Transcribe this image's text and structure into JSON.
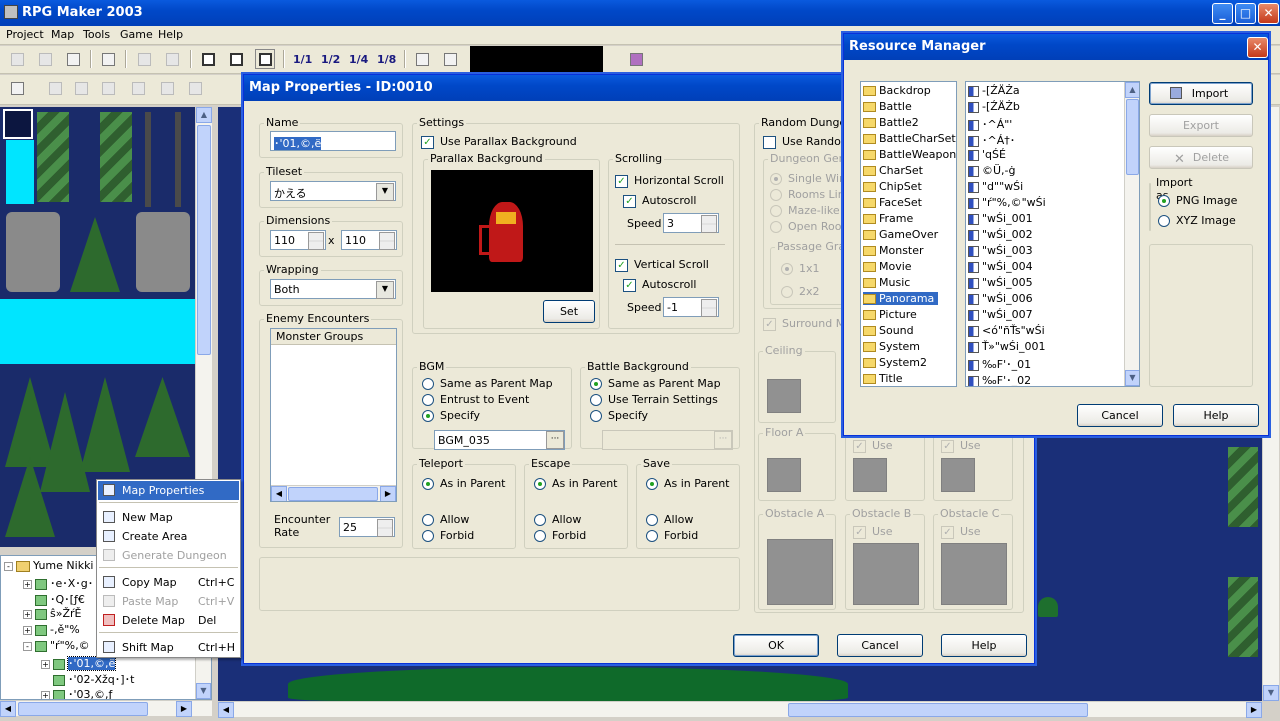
{
  "app": {
    "title": "RPG Maker 2003"
  },
  "menu": [
    "Project",
    "Map",
    "Tools",
    "Game",
    "Help"
  ],
  "toolbar_layer_buttons": [
    "1/1",
    "1/2",
    "1/4",
    "1/8"
  ],
  "tree": {
    "root": "Yume Nikki",
    "items": [
      "･e･X･g･",
      "･Q･[ƒ€",
      "ŝ»ŽŕĚ",
      "-‚ě\"%",
      "\"ŕ\"%‚©",
      "･'01,©,ë",
      "･'02-Xžq･]･t",
      "･'03,©,ƒ"
    ]
  },
  "context_menu": {
    "items": [
      {
        "label": "Map Properties",
        "shortcut": ""
      },
      {
        "label": "New Map",
        "shortcut": ""
      },
      {
        "label": "Create Area",
        "shortcut": ""
      },
      {
        "label": "Generate Dungeon",
        "shortcut": ""
      },
      {
        "label": "Copy Map",
        "shortcut": "Ctrl+C"
      },
      {
        "label": "Paste Map",
        "shortcut": "Ctrl+V"
      },
      {
        "label": "Delete Map",
        "shortcut": "Del"
      },
      {
        "label": "Shift Map",
        "shortcut": "Ctrl+H"
      }
    ]
  },
  "map_properties": {
    "title": "Map Properties - ID:0010",
    "name_label": "Name",
    "name_value": "･'01,©,ë",
    "tileset_label": "Tileset",
    "tileset_value": "かえる",
    "dimensions_label": "Dimensions",
    "width": "110",
    "height": "110",
    "x_sep": "x",
    "wrapping_label": "Wrapping",
    "wrapping_value": "Both",
    "encounters_label": "Enemy Encounters",
    "monster_groups_header": "Monster Groups",
    "encounter_rate_label": "Encounter Rate",
    "encounter_rate": "25",
    "settings_label": "Settings",
    "use_parallax": "Use Parallax Background",
    "parallax_label": "Parallax Background",
    "set_button": "Set",
    "scrolling_label": "Scrolling",
    "h_scroll": "Horizontal Scroll",
    "autoscroll": "Autoscroll",
    "speed_label": "Speed",
    "h_speed": "3",
    "v_scroll": "Vertical Scroll",
    "v_speed": "-1",
    "bgm_label": "BGM",
    "bgm_opt1": "Same as Parent Map",
    "bgm_opt2": "Entrust to Event",
    "bgm_opt3": "Specify",
    "bgm_value": "BGM_035",
    "battle_bg_label": "Battle Background",
    "bb_opt1": "Same as Parent Map",
    "bb_opt2": "Use Terrain Settings",
    "bb_opt3": "Specify",
    "teleport_label": "Teleport",
    "escape_label": "Escape",
    "save_label": "Save",
    "as_in_parent": "As in Parent",
    "allow": "Allow",
    "forbid": "Forbid",
    "random_dungeon_label": "Random Dungeon",
    "use_random": "Use Random",
    "dungeon_gen_label": "Dungeon Gener",
    "dg_opt1": "Single Wind",
    "dg_opt2": "Rooms Link",
    "dg_opt3": "Maze-like P",
    "dg_opt4": "Open Room",
    "passage_label": "Passage Gran",
    "pg_opt1": "1x1",
    "pg_opt2": "2x2",
    "surround": "Surround Ma",
    "ceiling_label": "Ceiling",
    "floor_a_label": "Floor A",
    "obstacle_a": "Obstacle A",
    "obstacle_b": "Obstacle B",
    "obstacle_c": "Obstacle C",
    "use": "Use",
    "ok": "OK",
    "cancel": "Cancel",
    "help": "Help"
  },
  "resource_manager": {
    "title": "Resource Manager",
    "folders": [
      "Backdrop",
      "Battle",
      "Battle2",
      "BattleCharSet",
      "BattleWeapon",
      "CharSet",
      "ChipSet",
      "FaceSet",
      "Frame",
      "GameOver",
      "Monster",
      "Movie",
      "Music",
      "Panorama",
      "Picture",
      "Sound",
      "System",
      "System2",
      "Title"
    ],
    "selected_folder": "Panorama",
    "files": [
      "-[ŹÄŻa",
      "-[ŹÄŻb",
      "･^Á\"'",
      "･^Á†･",
      "'qŚÉ",
      "©Ü,-ġ",
      "\"d\"\"wŚi",
      "\"ŕ\"%,©\"wŚi",
      "\"wŚi_001",
      "\"wŚi_002",
      "\"wŚi_003",
      "\"wŚi_004",
      "\"wŚi_005",
      "\"wŚi_006",
      "\"wŚi_007",
      "<ó\"ñŤs\"wŚi",
      "Ť»\"wŚi_001",
      "‰F'･_01",
      "‰F'･_02"
    ],
    "import": "Import",
    "export": "Export",
    "delete": "Delete",
    "import_as": "Import as",
    "png": "PNG Image",
    "xyz": "XYZ Image",
    "cancel": "Cancel",
    "help": "Help"
  }
}
